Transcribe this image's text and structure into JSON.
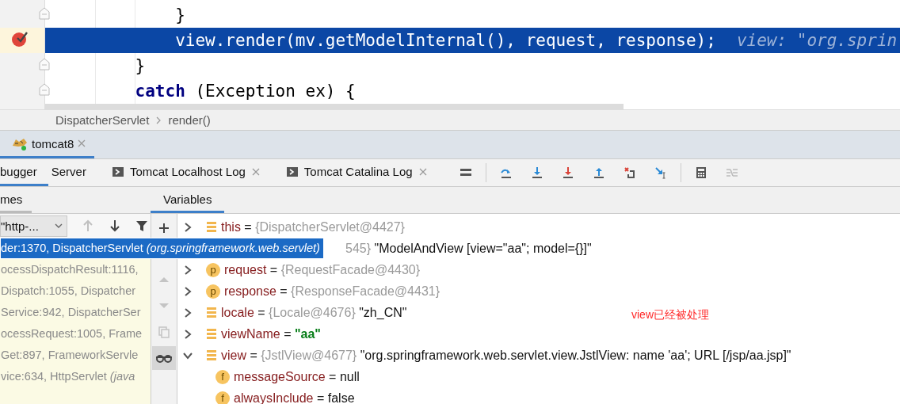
{
  "editor": {
    "lines": [
      {
        "tokens": [
          {
            "kind": "plain",
            "text": "        }"
          }
        ],
        "fold": true,
        "breakpoint": false,
        "current": false
      },
      {
        "tokens": [
          {
            "kind": "plain",
            "text": "        view.render(mv.getModelInternal(), request, response);"
          }
        ],
        "hint": "view: \"org.sprin",
        "fold": false,
        "breakpoint": true,
        "current": true
      },
      {
        "tokens": [
          {
            "kind": "plain",
            "text": "    }"
          }
        ],
        "fold": true,
        "breakpoint": false,
        "current": false
      },
      {
        "tokens": [
          {
            "kind": "keyword",
            "text": "    catch"
          },
          {
            "kind": "plain",
            "text": " (Exception ex) {"
          }
        ],
        "fold": true,
        "breakpoint": false,
        "current": false
      }
    ]
  },
  "breadcrumb": [
    "DispatcherServlet",
    "render()"
  ],
  "run_tabs": [
    {
      "label": "tomcat8",
      "selected": true,
      "closable": true
    }
  ],
  "debug_tabs": [
    {
      "label": "bugger",
      "selected": true,
      "console": false,
      "closable": false
    },
    {
      "label": "Server",
      "selected": false,
      "console": false,
      "closable": false
    },
    {
      "label": "Tomcat Localhost Log",
      "selected": false,
      "console": true,
      "closable": true
    },
    {
      "label": "Tomcat Catalina Log",
      "selected": false,
      "console": true,
      "closable": true
    }
  ],
  "toolbar": [
    {
      "kind": "layout",
      "disabled": false
    },
    {
      "kind": "separator"
    },
    {
      "kind": "step-over",
      "disabled": false
    },
    {
      "kind": "step-into",
      "disabled": false
    },
    {
      "kind": "force-step-into",
      "disabled": false
    },
    {
      "kind": "step-out",
      "disabled": false
    },
    {
      "kind": "drop-frame",
      "disabled": false
    },
    {
      "kind": "run-to-cursor",
      "disabled": false
    },
    {
      "kind": "separator"
    },
    {
      "kind": "evaluate",
      "disabled": false
    },
    {
      "kind": "trace",
      "disabled": true
    }
  ],
  "frames": {
    "title": "mes",
    "thread": "\"http-...",
    "nav": [
      {
        "kind": "up",
        "disabled": true
      },
      {
        "kind": "down",
        "disabled": false
      },
      {
        "kind": "filter",
        "disabled": false
      }
    ],
    "items": [
      {
        "text": "der:1370, DispatcherServlet *(org.springframework.web.servlet)*",
        "selected": true
      },
      {
        "text": "ocessDispatchResult:1116,",
        "selected": false
      },
      {
        "text": "Dispatch:1055, Dispatcher",
        "selected": false
      },
      {
        "text": "Service:942, DispatcherSer",
        "selected": false
      },
      {
        "text": "ocessRequest:1005, Frame",
        "selected": false
      },
      {
        "text": "Get:897, FrameworkServle",
        "selected": false
      },
      {
        "text": "vice:634, HttpServlet *(java*",
        "selected": false
      }
    ]
  },
  "side_tools": [
    {
      "kind": "add",
      "selected": false,
      "disabled": false
    },
    {
      "kind": "up",
      "selected": false,
      "disabled": true
    },
    {
      "kind": "down",
      "selected": false,
      "disabled": true
    },
    {
      "kind": "copy",
      "selected": false,
      "disabled": true
    },
    {
      "kind": "watches",
      "selected": true,
      "disabled": false
    }
  ],
  "variables": {
    "title": "Variables",
    "rows": [
      {
        "kind": "var",
        "name": "this",
        "op": "=",
        "ref": "{DispatcherServlet@4427}",
        "expanded": false
      },
      {
        "kind": "covered",
        "ref": "545}",
        "value": "\"ModelAndView [view=\"aa\"; model={}]\"",
        "string_value": false
      },
      {
        "kind": "var",
        "name": "request",
        "badge": "p",
        "op": "=",
        "ref": "{RequestFacade@4430}",
        "expanded": false
      },
      {
        "kind": "var",
        "name": "response",
        "badge": "p",
        "op": "=",
        "ref": "{ResponseFacade@4431}",
        "expanded": false
      },
      {
        "kind": "var",
        "name": "locale",
        "op": "=",
        "ref": "{Locale@4676}",
        "value": "\"zh_CN\"",
        "string_value": false,
        "expanded": false
      },
      {
        "kind": "var",
        "name": "viewName",
        "op": "=",
        "value": "\"aa\"",
        "string_value": true,
        "expanded": false
      },
      {
        "kind": "var",
        "name": "view",
        "op": "=",
        "ref": "{JstlView@4677}",
        "value": "\"org.springframework.web.servlet.view.JstlView: name 'aa'; URL [/jsp/aa.jsp]\"",
        "string_value": false,
        "expanded": true,
        "children": [
          {
            "kind": "var",
            "name": "messageSource",
            "badge": "f",
            "op": "=",
            "value": "null",
            "string_value": false
          },
          {
            "kind": "var",
            "name": "alwaysInclude",
            "badge": "f",
            "op": "=",
            "value": "false",
            "string_value": false
          }
        ]
      }
    ]
  },
  "annotation": "view已经被处理"
}
